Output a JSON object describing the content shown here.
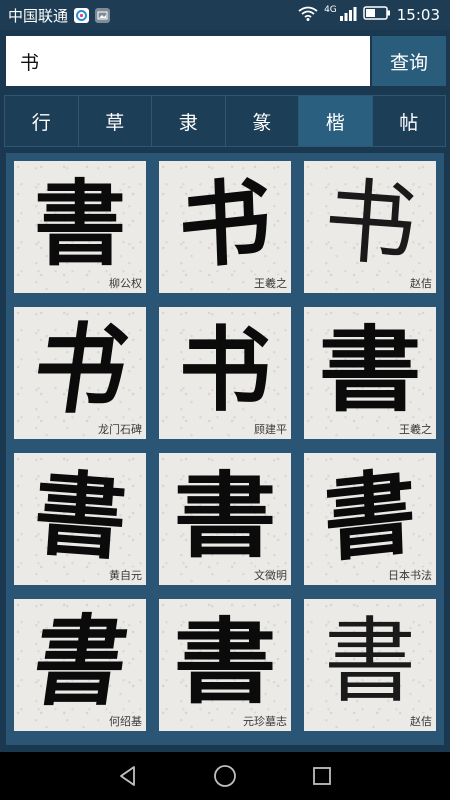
{
  "status": {
    "carrier": "中国联通",
    "network_label": "4G",
    "time": "15:03"
  },
  "search": {
    "value": "书",
    "button_label": "查询"
  },
  "tabs": [
    {
      "label": "行",
      "active": false
    },
    {
      "label": "草",
      "active": false
    },
    {
      "label": "隶",
      "active": false
    },
    {
      "label": "篆",
      "active": false
    },
    {
      "label": "楷",
      "active": true
    },
    {
      "label": "帖",
      "active": false
    }
  ],
  "results": [
    {
      "glyph": "書",
      "author": "柳公权"
    },
    {
      "glyph": "书",
      "author": "王羲之"
    },
    {
      "glyph": "书",
      "author": "赵佶"
    },
    {
      "glyph": "书",
      "author": "龙门石碑"
    },
    {
      "glyph": "书",
      "author": "顾建平"
    },
    {
      "glyph": "書",
      "author": "王羲之"
    },
    {
      "glyph": "書",
      "author": "黄自元"
    },
    {
      "glyph": "書",
      "author": "文徵明"
    },
    {
      "glyph": "書",
      "author": "日本书法"
    },
    {
      "glyph": "書",
      "author": "何绍基"
    },
    {
      "glyph": "書",
      "author": "元珍墓志"
    },
    {
      "glyph": "書",
      "author": "赵佶"
    }
  ],
  "colors": {
    "background": "#1a3850",
    "accent": "#2a5d7c",
    "active_tab": "#2a5f80"
  },
  "icons": {
    "status": [
      "wifi-icon",
      "signal-icon",
      "battery-icon"
    ],
    "nav": [
      "back-icon",
      "home-icon",
      "recents-icon"
    ]
  }
}
